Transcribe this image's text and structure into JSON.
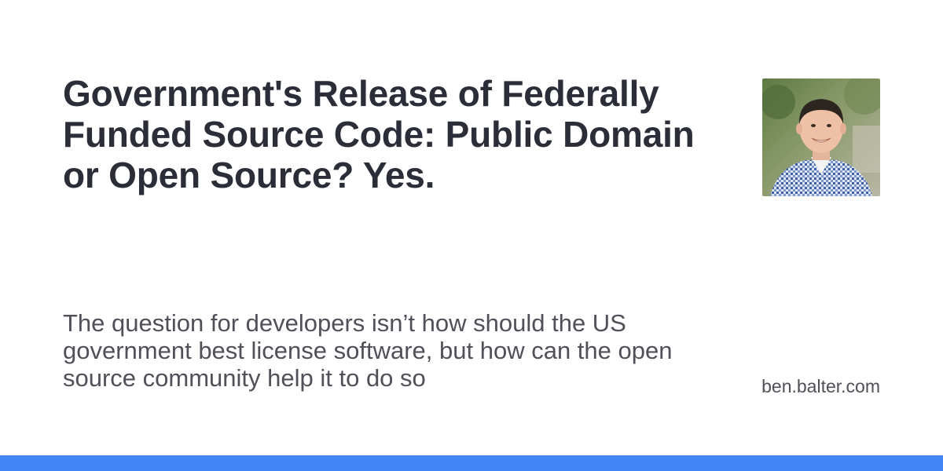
{
  "card": {
    "title": "Government's Release of Federally Funded Source Code: Public Domain or Open Source? Yes.",
    "description": "The question for developers isn’t how should the US government best license software, but how can the open source community help it to do so",
    "site": "ben.balter.com",
    "avatar_icon": "person-photo-icon"
  },
  "colors": {
    "accent_bar": "#4285f4",
    "title": "#2b2d38",
    "body_text": "#4f5058"
  }
}
